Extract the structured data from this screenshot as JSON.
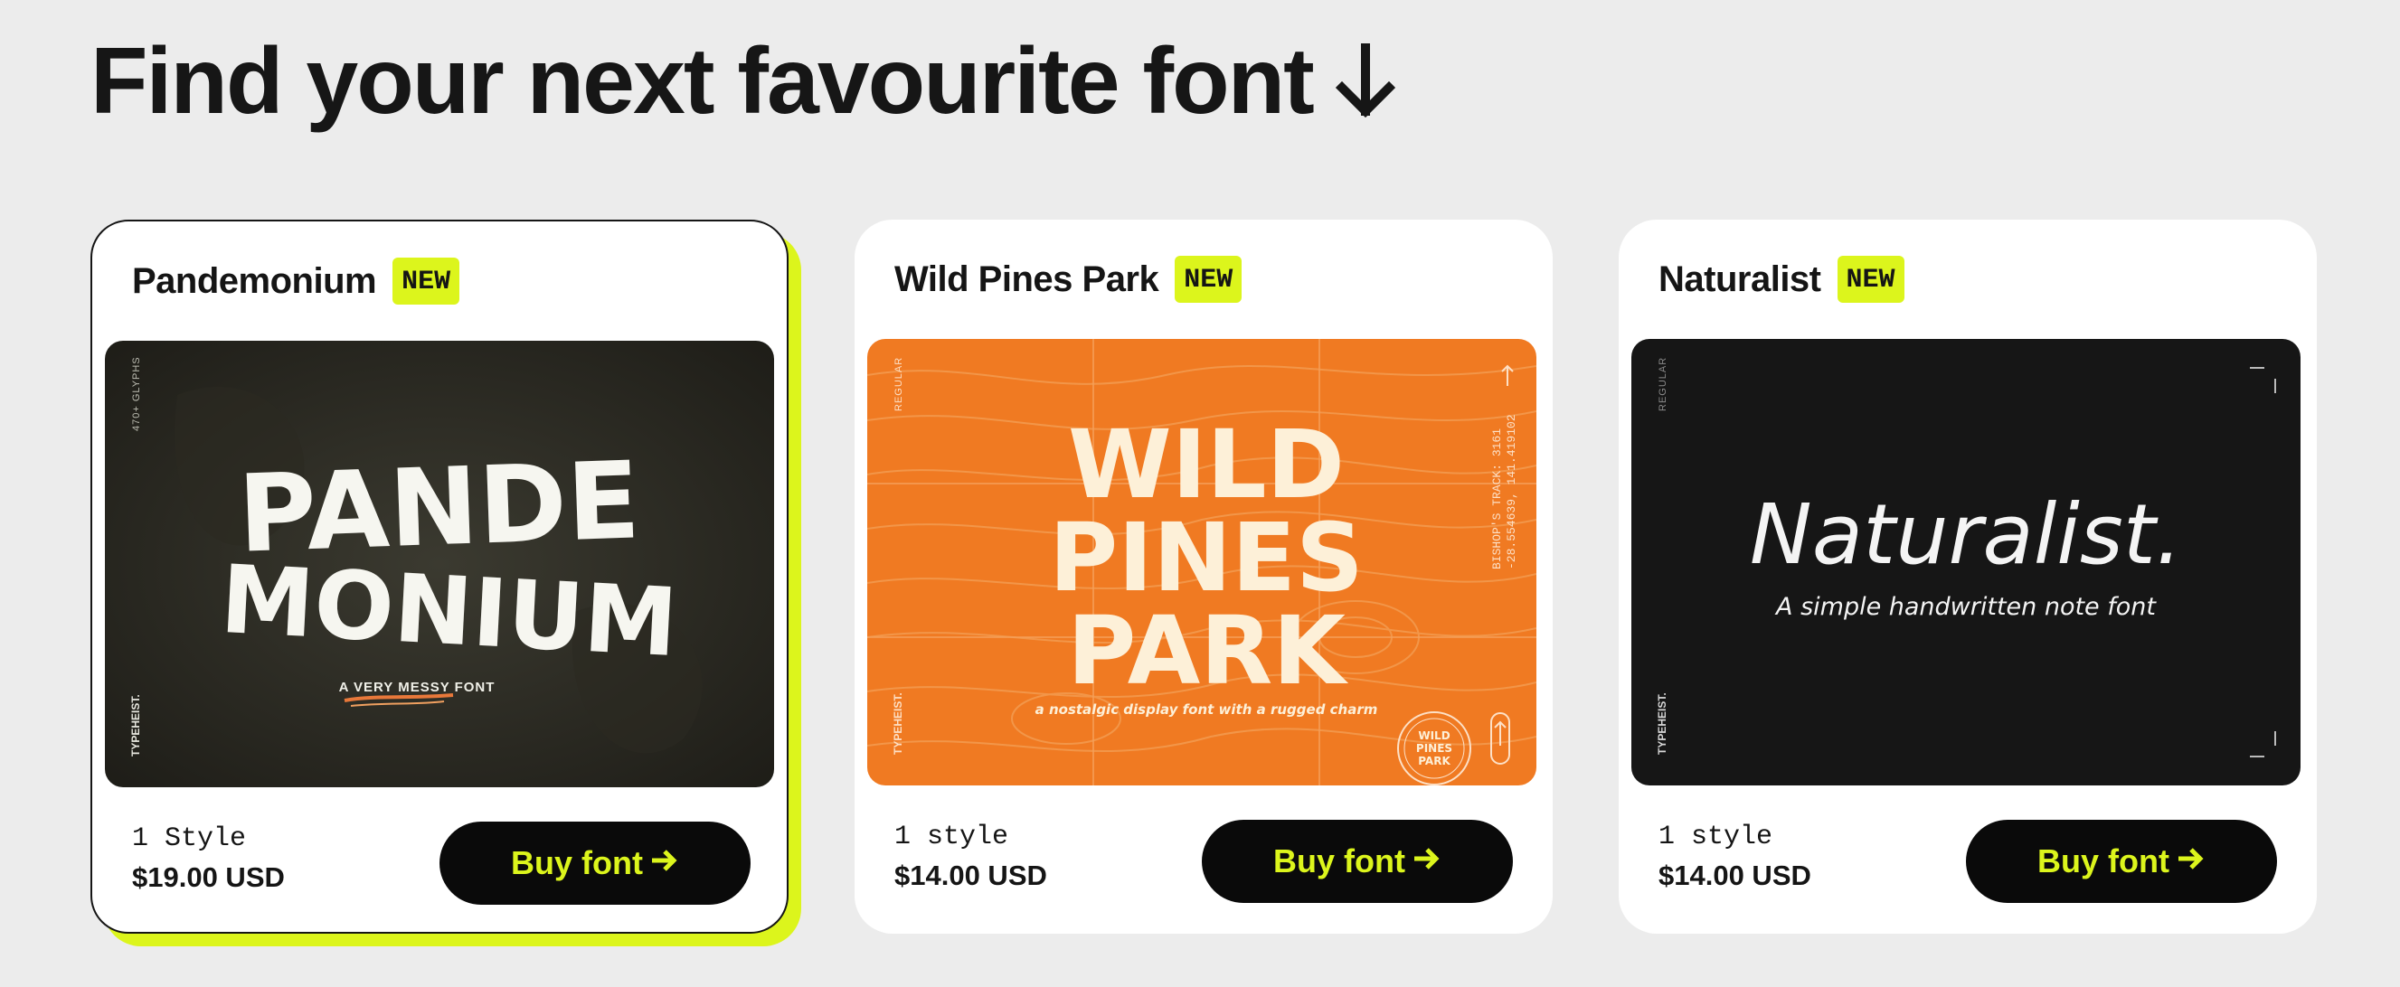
{
  "heading": {
    "title": "Find your next favourite font",
    "icon": "arrow-down-icon"
  },
  "colors": {
    "accent": "#dcf51c",
    "button": "#0a0a0a",
    "background": "#ececec"
  },
  "fonts": [
    {
      "name": "Pandemonium",
      "badge": "NEW",
      "styles": "1 Style",
      "price": "$19.00 USD",
      "buy_label": "Buy font",
      "buy_icon": "arrow-right-icon",
      "featured": true,
      "preview": {
        "line1": "PANDE",
        "line2": "MONIUM",
        "tagline": "A VERY MESSY FONT",
        "side_top": "470+ GLYPHS",
        "side_bottom": "TYPEHEIST."
      }
    },
    {
      "name": "Wild Pines Park",
      "badge": "NEW",
      "styles": "1 style",
      "price": "$14.00 USD",
      "buy_label": "Buy font",
      "buy_icon": "arrow-right-icon",
      "featured": false,
      "preview": {
        "line1": "WILD",
        "line2": "PINES",
        "line3": "PARK",
        "tagline": "a nostalgic display font with a rugged charm",
        "side_top": "REGULAR",
        "side_bottom": "TYPEHEIST.",
        "coords1": "BISHOP'S TRACK: 3161",
        "coords2": "-28.554639, 141.419102",
        "stamp_line1": "WILD",
        "stamp_line2": "PINES",
        "stamp_line3": "PARK"
      }
    },
    {
      "name": "Naturalist",
      "badge": "NEW",
      "styles": "1 style",
      "price": "$14.00 USD",
      "buy_label": "Buy font",
      "buy_icon": "arrow-right-icon",
      "featured": false,
      "preview": {
        "title": "Naturalist.",
        "tagline": "A simple handwritten note font",
        "side_top": "REGULAR",
        "side_bottom": "TYPEHEIST."
      }
    }
  ]
}
